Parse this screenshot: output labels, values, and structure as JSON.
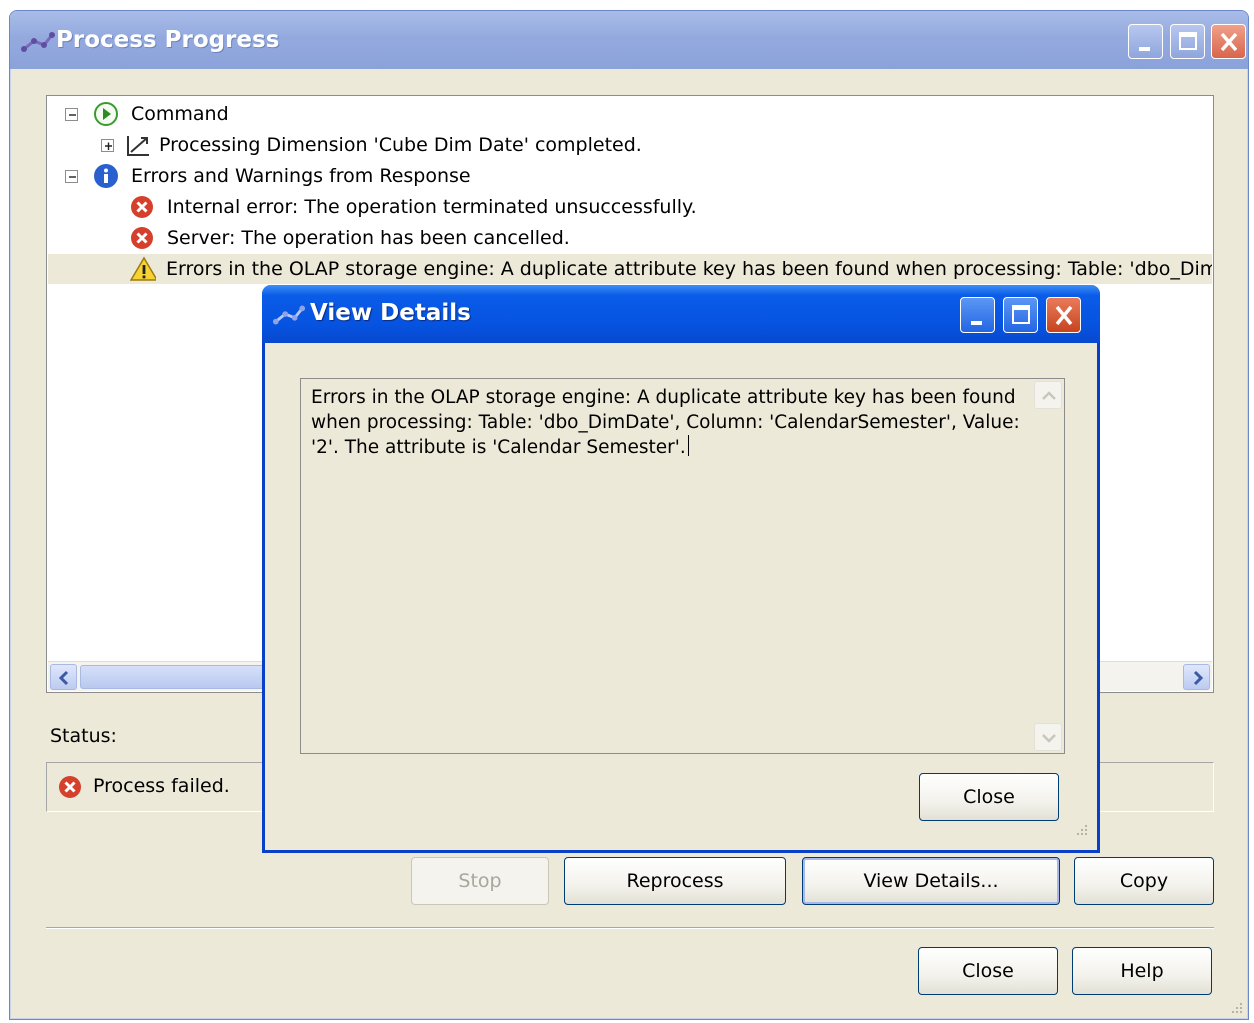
{
  "window": {
    "title": "Process Progress",
    "accent": "#8ba2da"
  },
  "tree": {
    "items": [
      {
        "text": "Command",
        "icon": "play-icon",
        "expander": "minus"
      },
      {
        "text": "Processing Dimension 'Cube Dim Date' completed.",
        "icon": "dimension-icon",
        "expander": "plus"
      },
      {
        "text": "Errors and Warnings from Response",
        "icon": "info-icon",
        "expander": "minus"
      },
      {
        "text": "Internal error: The operation terminated unsuccessfully.",
        "icon": "error-icon"
      },
      {
        "text": "Server: The operation has been cancelled.",
        "icon": "error-icon"
      },
      {
        "text": "Errors in the OLAP storage engine: A duplicate attribute key has been found when processing: Table: 'dbo_DimDa",
        "icon": "warning-icon",
        "selected": true
      }
    ]
  },
  "status": {
    "label": "Status:",
    "text": "Process failed."
  },
  "buttons": {
    "stop": "Stop",
    "reprocess": "Reprocess",
    "view_details": "View Details...",
    "copy": "Copy",
    "close": "Close",
    "help": "Help"
  },
  "dialog": {
    "title": "View Details",
    "text": "Errors in the OLAP storage engine: A duplicate attribute key has been found when processing: Table: 'dbo_DimDate', Column: 'CalendarSemester', Value: '2'. The attribute is 'Calendar Semester'.",
    "close": "Close",
    "accent": "#0653e0"
  }
}
